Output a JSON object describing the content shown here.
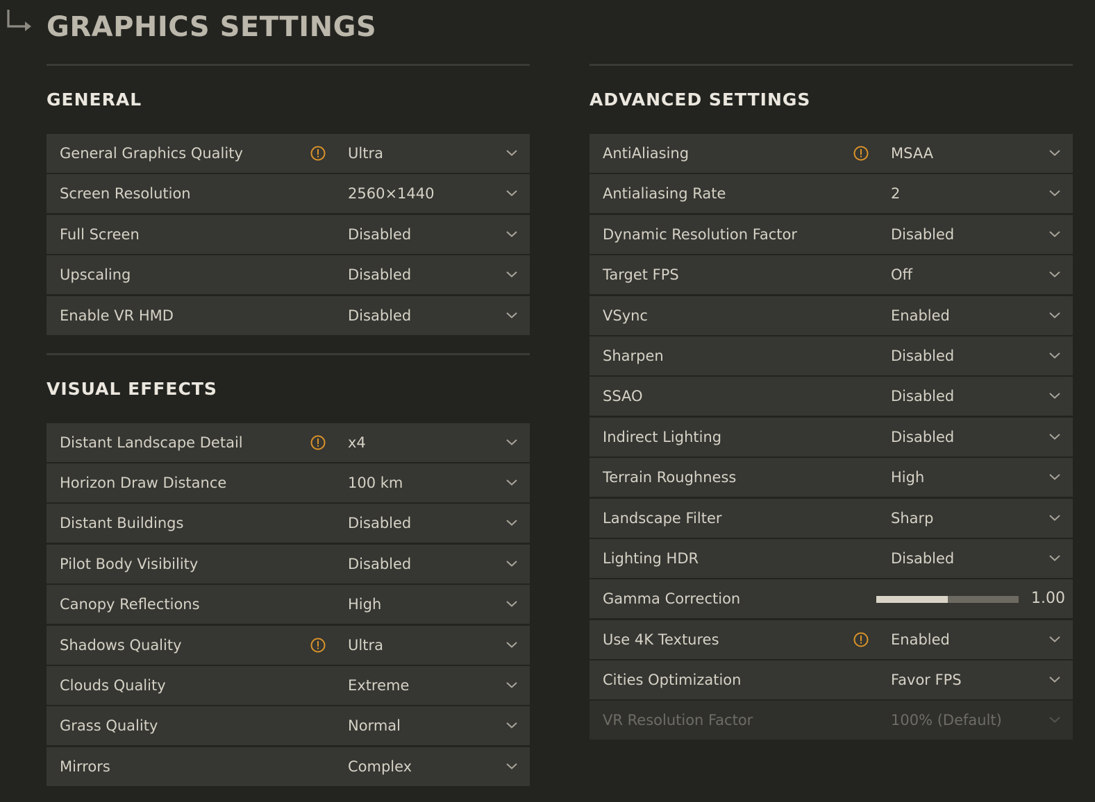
{
  "page": {
    "title": "GRAPHICS SETTINGS",
    "back_icon": "return-arrow-icon"
  },
  "colors": {
    "background": "#232420",
    "row": "#363632",
    "warning": "#d9932a",
    "title": "#bcb7ab"
  },
  "general": {
    "title": "GENERAL",
    "rows": [
      {
        "label": "General Graphics Quality",
        "value": "Ultra",
        "warning": true
      },
      {
        "label": "Screen Resolution",
        "value": "2560×1440",
        "warning": false
      },
      {
        "label": "Full Screen",
        "value": "Disabled",
        "warning": false
      },
      {
        "label": "Upscaling",
        "value": "Disabled",
        "warning": false
      },
      {
        "label": "Enable VR HMD",
        "value": "Disabled",
        "warning": false
      }
    ]
  },
  "visual_effects": {
    "title": "VISUAL EFFECTS",
    "rows": [
      {
        "label": "Distant Landscape Detail",
        "value": "x4",
        "warning": true
      },
      {
        "label": "Horizon Draw Distance",
        "value": "100 km",
        "warning": false
      },
      {
        "label": "Distant Buildings",
        "value": "Disabled",
        "warning": false
      },
      {
        "label": "Pilot Body Visibility",
        "value": "Disabled",
        "warning": false
      },
      {
        "label": "Canopy Reflections",
        "value": "High",
        "warning": false
      },
      {
        "label": "Shadows Quality",
        "value": "Ultra",
        "warning": true
      },
      {
        "label": "Clouds Quality",
        "value": "Extreme",
        "warning": false
      },
      {
        "label": "Grass Quality",
        "value": "Normal",
        "warning": false
      },
      {
        "label": "Mirrors",
        "value": "Complex",
        "warning": false
      }
    ]
  },
  "advanced": {
    "title": "ADVANCED SETTINGS",
    "rows": [
      {
        "label": "AntiAliasing",
        "value": "MSAA",
        "warning": true
      },
      {
        "label": "Antialiasing Rate",
        "value": "2",
        "warning": false
      },
      {
        "label": "Dynamic Resolution Factor",
        "value": "Disabled",
        "warning": false
      },
      {
        "label": "Target FPS",
        "value": "Off",
        "warning": false
      },
      {
        "label": "VSync",
        "value": "Enabled",
        "warning": false
      },
      {
        "label": "Sharpen",
        "value": "Disabled",
        "warning": false
      },
      {
        "label": "SSAO",
        "value": "Disabled",
        "warning": false
      },
      {
        "label": "Indirect Lighting",
        "value": "Disabled",
        "warning": false
      },
      {
        "label": "Terrain Roughness",
        "value": "High",
        "warning": false
      },
      {
        "label": "Landscape Filter",
        "value": "Sharp",
        "warning": false
      },
      {
        "label": "Lighting HDR",
        "value": "Disabled",
        "warning": false
      },
      {
        "label": "Gamma Correction",
        "type": "slider",
        "value": "1.00",
        "fill_fraction": 0.5,
        "warning": false
      },
      {
        "label": "Use 4K Textures",
        "value": "Enabled",
        "warning": true
      },
      {
        "label": "Cities Optimization",
        "value": "Favor FPS",
        "warning": false
      },
      {
        "label": "VR Resolution Factor",
        "value": "100% (Default)",
        "warning": false,
        "disabled": true
      }
    ]
  }
}
